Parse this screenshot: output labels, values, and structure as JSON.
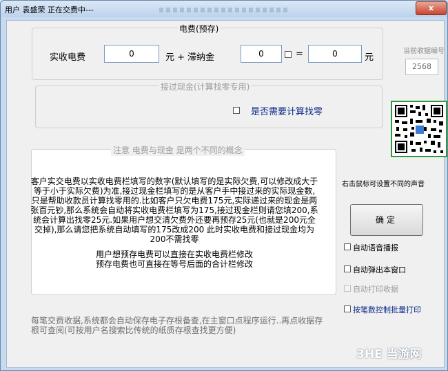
{
  "window": {
    "title": "用户 袁盛荣 正在交费中---",
    "close_glyph": "x"
  },
  "fee_group": {
    "label": "电费(预存)",
    "paid_label": "实收电费",
    "paid_value": "0",
    "unit_plus": "元 + 滞纳金",
    "late_fee_value": "0",
    "equals": "=",
    "total_value": "0",
    "unit": "元"
  },
  "receipt": {
    "label": "当前收据编号",
    "value": "2568"
  },
  "cash_group": {
    "label": "接过现金(计算找零专用)",
    "need_change_label": "是否需要计算找零"
  },
  "notice_group": {
    "label": "注意  电费与现金  是两个不同的概念",
    "paragraph1": "客户实交电费以实收电费栏填写的数字(默认填写的是实际欠费,可以修改成大于等于小于实际欠费)为准,接过现金栏填写的是从客户手中接过来的实际现金数,只是帮助收款员计算找零用的.比如客户只欠电费175元,实际递过来的现金是两张百元钞,那么系统会自动将实收电费栏填写为175,接过现金栏则请您填200,系统会计算出找零25元.如果用户想交清欠费外还要再预存25元(也就是200元全交掉),那么请您把系统自动填写的175改成200  此时实收电费和接过现金均为200不需找零",
    "paragraph2": "用户想预存电费可以直接在实收电费栏修改",
    "paragraph3": "预存电费也可直接在等号后面的合计栏修改"
  },
  "right_panel": {
    "sound_hint": "右击鼠标可设置不同的声音",
    "ok_button": "确定",
    "options": [
      {
        "label": "自动语音播报",
        "checked": false,
        "enabled": true
      },
      {
        "label": "自动弹出本窗口",
        "checked": false,
        "enabled": true
      },
      {
        "label": "自动打印收据",
        "checked": false,
        "enabled": false
      },
      {
        "label": "按笔数控制批量打印",
        "checked": false,
        "enabled": true
      }
    ]
  },
  "footer": "每笔交费收据,系统都会自动保存电子存根备查,在主窗口点程序运行..再点收据存根可查阅(可按用户名搜索比传统的纸质存根查找更方便)",
  "watermark": "3HE 当游网",
  "colors": {
    "window_frame": "#c6daf0",
    "client_bg": "#f0f0f0",
    "input_border": "#7a9cc0",
    "link_blue": "#0a2a8a"
  },
  "icons": [
    "close-icon",
    "qr-code-icon",
    "checkbox-icon"
  ]
}
